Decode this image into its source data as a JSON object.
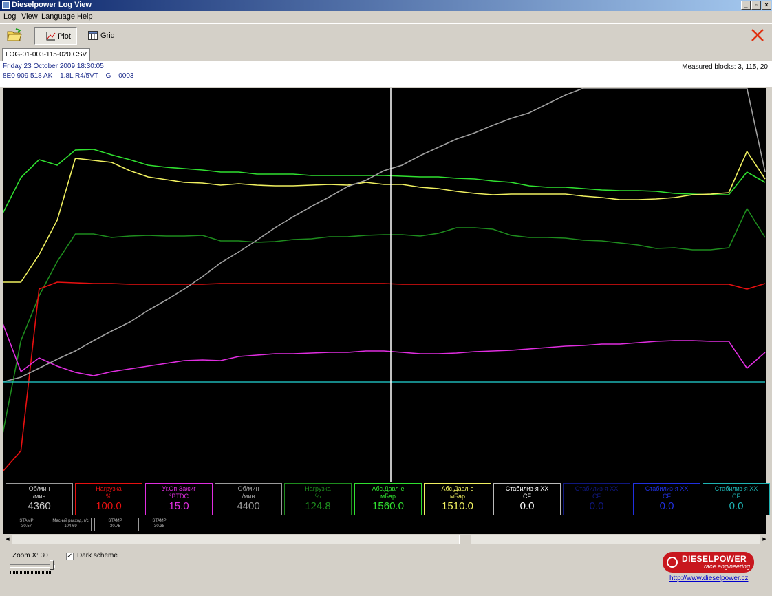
{
  "window": {
    "title": "Dieselpower Log View",
    "min": "_",
    "max": "▫",
    "close": "×"
  },
  "menu": [
    "Log",
    "View",
    "Language",
    "Help"
  ],
  "toolbar": {
    "plot_label": "Plot",
    "grid_label": "Grid"
  },
  "tab": {
    "label": "LOG-01-003-115-020.CSV"
  },
  "info": {
    "date": "Friday 23 October 2009 18:30:05",
    "part": "8E0 909 518 AK",
    "engine": "1.8L R4/5VT",
    "g": "G",
    "code": "0003",
    "measured_blocks": "Measured blocks: 3, 115, 20"
  },
  "colors": {
    "white": "#c8c8c8",
    "red": "#e81010",
    "magenta": "#e02ee0",
    "gray": "#a0a0a0",
    "darkgreen": "#1e8c1e",
    "green": "#30e030",
    "yellow": "#f0f060",
    "cyan": "#1eb4b4",
    "navy": "#101880",
    "blue": "#2030e0"
  },
  "gauges": [
    {
      "name": "gauge-rpm-1",
      "label1": "Об/мин",
      "label2": "/мин",
      "value": "4360",
      "color": "#c8c8c8",
      "border": "#9a9a9a"
    },
    {
      "name": "gauge-load-1",
      "label1": "Нагрузка",
      "label2": "%",
      "value": "100.0",
      "color": "#e81010",
      "border": "#e81010"
    },
    {
      "name": "gauge-ignition",
      "label1": "Уг.Оп.Зажиг",
      "label2": "°BTDC",
      "value": "15.0",
      "color": "#e02ee0",
      "border": "#e02ee0"
    },
    {
      "name": "gauge-rpm-2",
      "label1": "Об/мин",
      "label2": "/мин",
      "value": "4400",
      "color": "#a0a0a0",
      "border": "#9a9a9a"
    },
    {
      "name": "gauge-load-2",
      "label1": "Нагрузка",
      "label2": "%",
      "value": "124.8",
      "color": "#1e8c1e",
      "border": "#1e8c1e"
    },
    {
      "name": "gauge-abs-pressure-1",
      "label1": "Абс.Давл-е",
      "label2": "мБар",
      "value": "1560.0",
      "color": "#30e030",
      "border": "#30e030"
    },
    {
      "name": "gauge-abs-pressure-2",
      "label1": "Абс.Давл-е",
      "label2": "мБар",
      "value": "1510.0",
      "color": "#f0f060",
      "border": "#f0f060"
    },
    {
      "name": "gauge-idle-stab-1",
      "label1": "Стабилиз-я XX",
      "label2": "CF",
      "value": "0.0",
      "color": "#ffffff",
      "border": "#bbbbbb"
    },
    {
      "name": "gauge-idle-stab-2",
      "label1": "Стабилиз-я XX",
      "label2": "CF",
      "value": "0.0",
      "color": "#101880",
      "border": "#101880"
    },
    {
      "name": "gauge-idle-stab-3",
      "label1": "Стабилиз-я XX",
      "label2": "CF",
      "value": "0.0",
      "color": "#2030e0",
      "border": "#2030e0"
    },
    {
      "name": "gauge-idle-stab-4",
      "label1": "Стабилиз-я XX",
      "label2": "CF",
      "value": "0.0",
      "color": "#1eb4b4",
      "border": "#1eb4b4"
    }
  ],
  "stamps": [
    {
      "label": "STAMP",
      "value": "30.57"
    },
    {
      "label": "Мас-ый расход. г/с",
      "value": "104.69"
    },
    {
      "label": "STAMP",
      "value": "30.75"
    },
    {
      "label": "STAMP",
      "value": "30.38"
    }
  ],
  "bottom": {
    "zoom_label": "Zoom X: 30",
    "zoom_value": 30,
    "dark_scheme_label": "Dark scheme",
    "dark_scheme_checked": true,
    "link": "http://www.dieselpower.cz",
    "logo_title": "DIESELPOWER",
    "logo_subtitle": "race engineering"
  },
  "chart_data": {
    "type": "line",
    "x": [
      0,
      1,
      2,
      3,
      4,
      5,
      6,
      7,
      8,
      9,
      10,
      11,
      12,
      13,
      14,
      15,
      16,
      17,
      18,
      19,
      20,
      21,
      22,
      23,
      24,
      25,
      26,
      27,
      28,
      29,
      30,
      31,
      32,
      33,
      34,
      35,
      36,
      37,
      38,
      39,
      40,
      41,
      42
    ],
    "cursor_index": 21,
    "series": [
      {
        "color": "#30e030",
        "values": [
          310,
          258,
          232,
          240,
          218,
          217,
          225,
          232,
          240,
          243,
          245,
          247,
          250,
          250,
          253,
          253,
          253,
          255,
          255,
          255,
          255,
          255,
          256,
          257,
          257,
          259,
          260,
          263,
          265,
          270,
          272,
          272,
          274,
          276,
          277,
          277,
          278,
          281,
          282,
          283,
          283,
          250,
          265
        ]
      },
      {
        "color": "#f0f060",
        "values": [
          410,
          410,
          370,
          320,
          230,
          233,
          236,
          248,
          257,
          261,
          265,
          266,
          269,
          267,
          269,
          270,
          270,
          269,
          268,
          269,
          265,
          268,
          268,
          272,
          274,
          278,
          281,
          283,
          282,
          282,
          282,
          282,
          285,
          287,
          290,
          290,
          289,
          287,
          283,
          282,
          280,
          220,
          260
        ]
      },
      {
        "color": "#1e8c1e",
        "values": [
          630,
          495,
          430,
          380,
          340,
          340,
          345,
          343,
          342,
          343,
          343,
          342,
          350,
          350,
          352,
          351,
          348,
          347,
          344,
          344,
          342,
          341,
          341,
          343,
          339,
          331,
          331,
          333,
          342,
          345,
          345,
          346,
          349,
          350,
          353,
          356,
          361,
          360,
          363,
          363,
          360,
          303,
          345
        ]
      },
      {
        "color": "#e81010",
        "values": [
          685,
          655,
          420,
          410,
          411,
          412,
          412,
          413,
          413,
          413,
          413,
          413,
          412,
          412,
          412,
          412,
          412,
          412,
          412,
          412,
          412,
          412,
          413,
          413,
          413,
          413,
          413,
          413,
          413,
          413,
          413,
          413,
          413,
          413,
          413,
          413,
          413,
          413,
          413,
          413,
          413,
          420,
          412
        ]
      },
      {
        "color": "#e02ee0",
        "values": [
          470,
          540,
          520,
          532,
          541,
          546,
          540,
          536,
          532,
          528,
          524,
          523,
          524,
          518,
          516,
          514,
          514,
          513,
          512,
          512,
          510,
          510,
          512,
          514,
          514,
          513,
          511,
          510,
          509,
          507,
          505,
          503,
          502,
          500,
          500,
          498,
          496,
          495,
          495,
          496,
          496,
          535,
          512
        ]
      },
      {
        "color": "#a0a0a0",
        "values": [
          555,
          548,
          535,
          522,
          510,
          495,
          481,
          468,
          451,
          436,
          420,
          402,
          382,
          366,
          349,
          331,
          315,
          300,
          286,
          271,
          262,
          248,
          240,
          226,
          214,
          202,
          193,
          182,
          172,
          164,
          151,
          138,
          128,
          128,
          128,
          128,
          128,
          128,
          128,
          128,
          128,
          128,
          250
        ]
      },
      {
        "color": "#1eb4b4",
        "values": [
          555,
          555,
          555,
          555,
          555,
          555,
          555,
          555,
          555,
          555,
          555,
          555,
          555,
          555,
          555,
          555,
          555,
          555,
          555,
          555,
          555,
          555,
          555,
          555,
          555,
          555,
          555,
          555,
          555,
          555,
          555,
          555,
          555,
          555,
          555,
          555,
          555,
          555,
          555,
          555,
          555,
          555,
          555
        ]
      }
    ]
  }
}
